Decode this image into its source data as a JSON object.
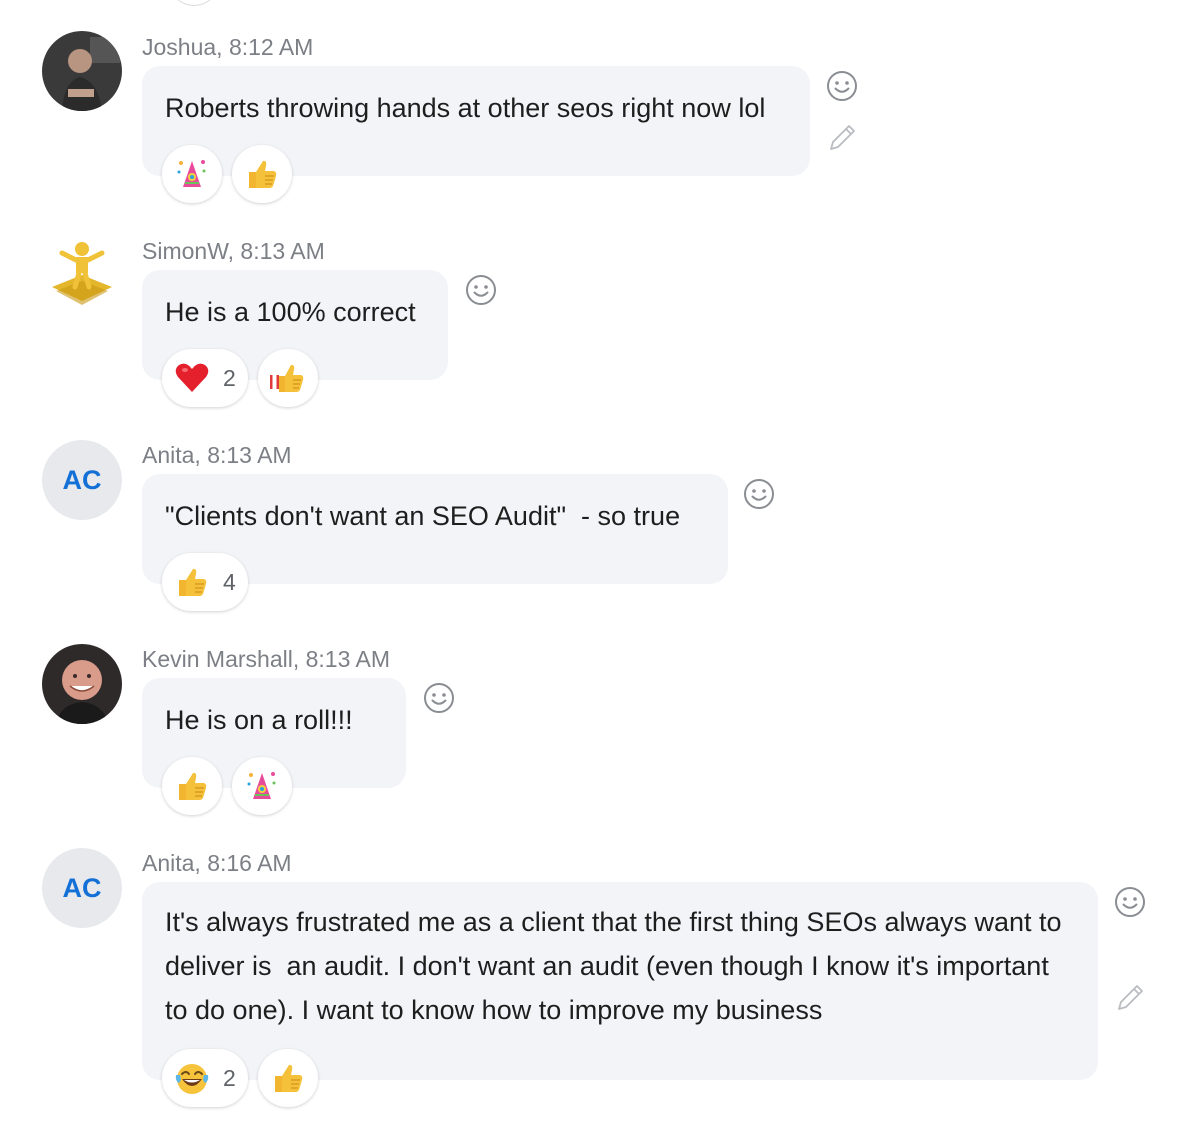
{
  "messages": [
    {
      "author": "Joshua, 8:12 AM",
      "avatar": "user-photo",
      "text": "Roberts throwing hands at other seos right now lol",
      "reactions": [
        {
          "icon": "party-hat-icon",
          "count": ""
        },
        {
          "icon": "thumbs-up-icon",
          "count": ""
        }
      ],
      "actions": [
        "add-reaction-icon",
        "edit-pencil-icon"
      ]
    },
    {
      "author": "SimonW, 8:13 AM",
      "avatar": "gold-puzzle-figure",
      "text": "He is a 100% correct",
      "reactions": [
        {
          "icon": "red-heart-icon",
          "count": "2"
        },
        {
          "icon": "thumbs-up-with-flag-icon",
          "count": ""
        }
      ],
      "actions": [
        "add-reaction-icon"
      ]
    },
    {
      "author": "Anita, 8:13 AM",
      "avatar_initials": "AC",
      "text": "\"Clients don't want an SEO Audit\"  - so true",
      "reactions": [
        {
          "icon": "thumbs-up-icon",
          "count": "4"
        }
      ],
      "actions": [
        "add-reaction-icon"
      ]
    },
    {
      "author": "Kevin Marshall, 8:13 AM",
      "avatar": "user-photo",
      "text": "He is on a roll!!!",
      "reactions": [
        {
          "icon": "thumbs-up-icon",
          "count": ""
        },
        {
          "icon": "party-hat-icon",
          "count": ""
        }
      ],
      "actions": [
        "add-reaction-icon"
      ]
    },
    {
      "author": "Anita, 8:16 AM",
      "avatar_initials": "AC",
      "text": "It's always frustrated me as a client that the first thing SEOs always want to deliver is  an audit. I don't want an audit (even though I know it's important to do one). I want to know how to improve my business",
      "reactions": [
        {
          "icon": "laughing-tears-icon",
          "count": "2"
        },
        {
          "icon": "thumbs-up-icon",
          "count": ""
        }
      ],
      "actions": [
        "add-reaction-icon",
        "edit-pencil-icon"
      ]
    }
  ],
  "colors": {
    "bubble": "#f2f4f7",
    "meta_text": "#7c7f85",
    "initials": "#1370d6",
    "initials_bg": "#e8e9ec"
  }
}
